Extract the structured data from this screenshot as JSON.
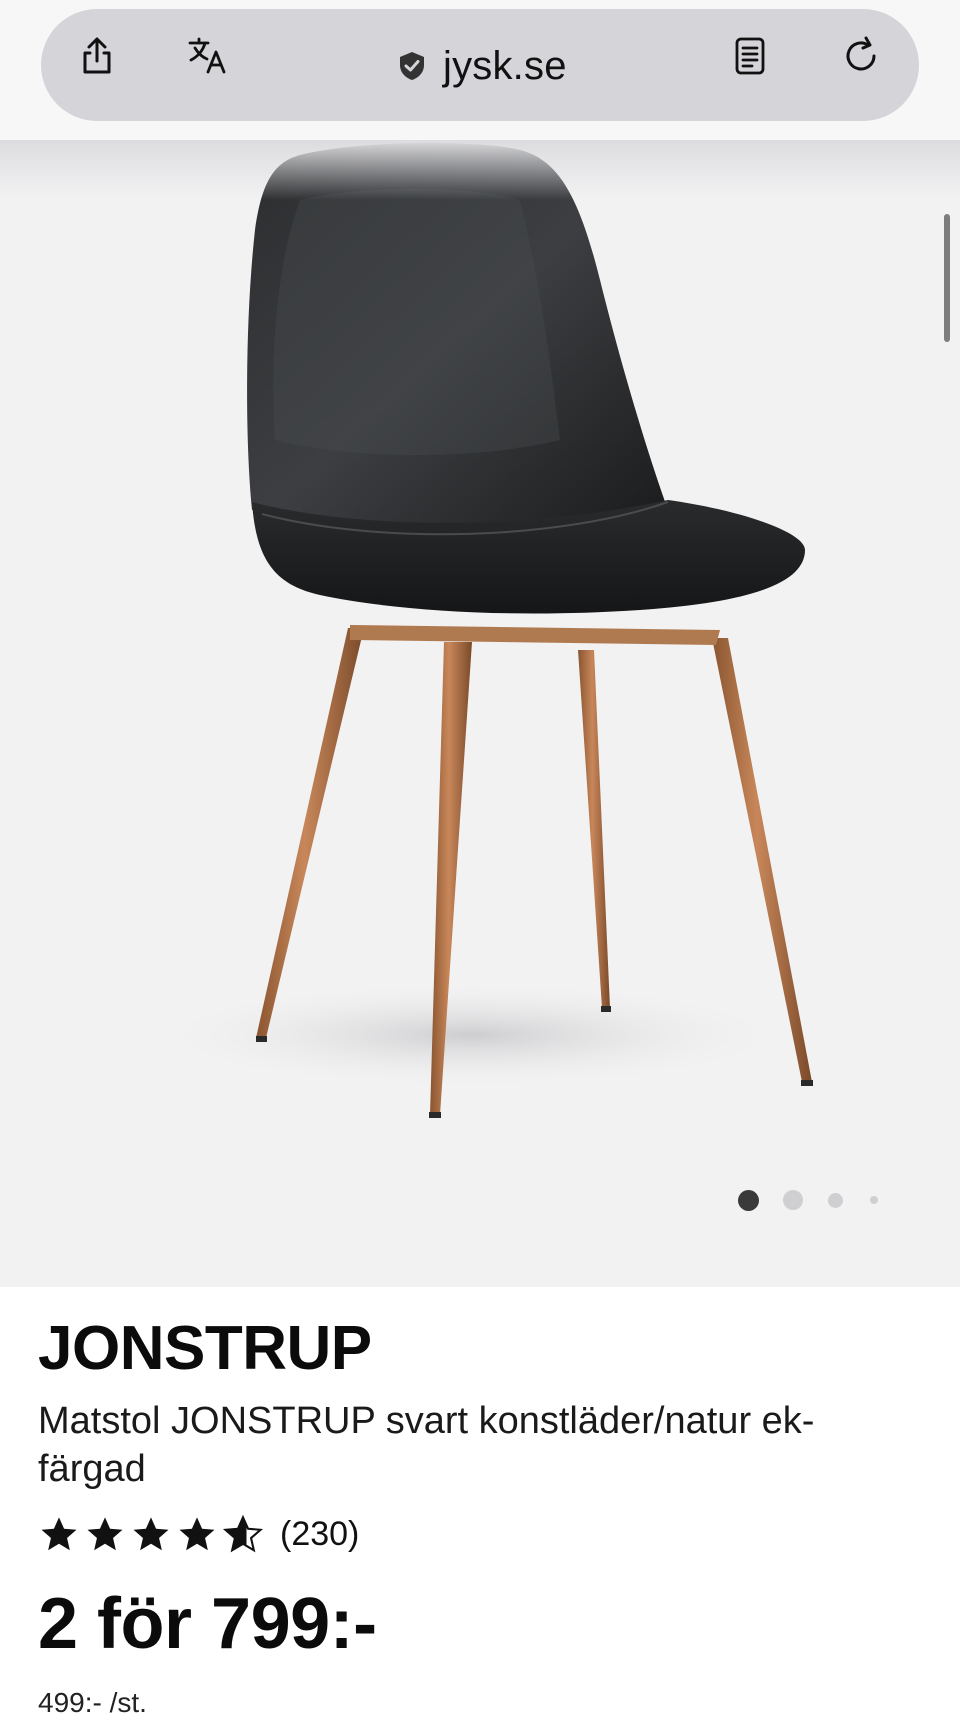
{
  "browser": {
    "url": "jysk.se"
  },
  "gallery": {
    "image_alt_name": "chair-photo",
    "slide_count": 4,
    "active_slide": 1
  },
  "product": {
    "brand": "JONSTRUP",
    "name": "Matstol JONSTRUP svart konstläder/natur ek-färgad",
    "rating_stars": 4.5,
    "review_count": "(230)",
    "price": "2 för 799:-",
    "unit_price": "499:- /st."
  },
  "colors": {
    "pill": "#d4d4d9",
    "gallery_bg": "#f3f2f3",
    "text": "#111111"
  }
}
